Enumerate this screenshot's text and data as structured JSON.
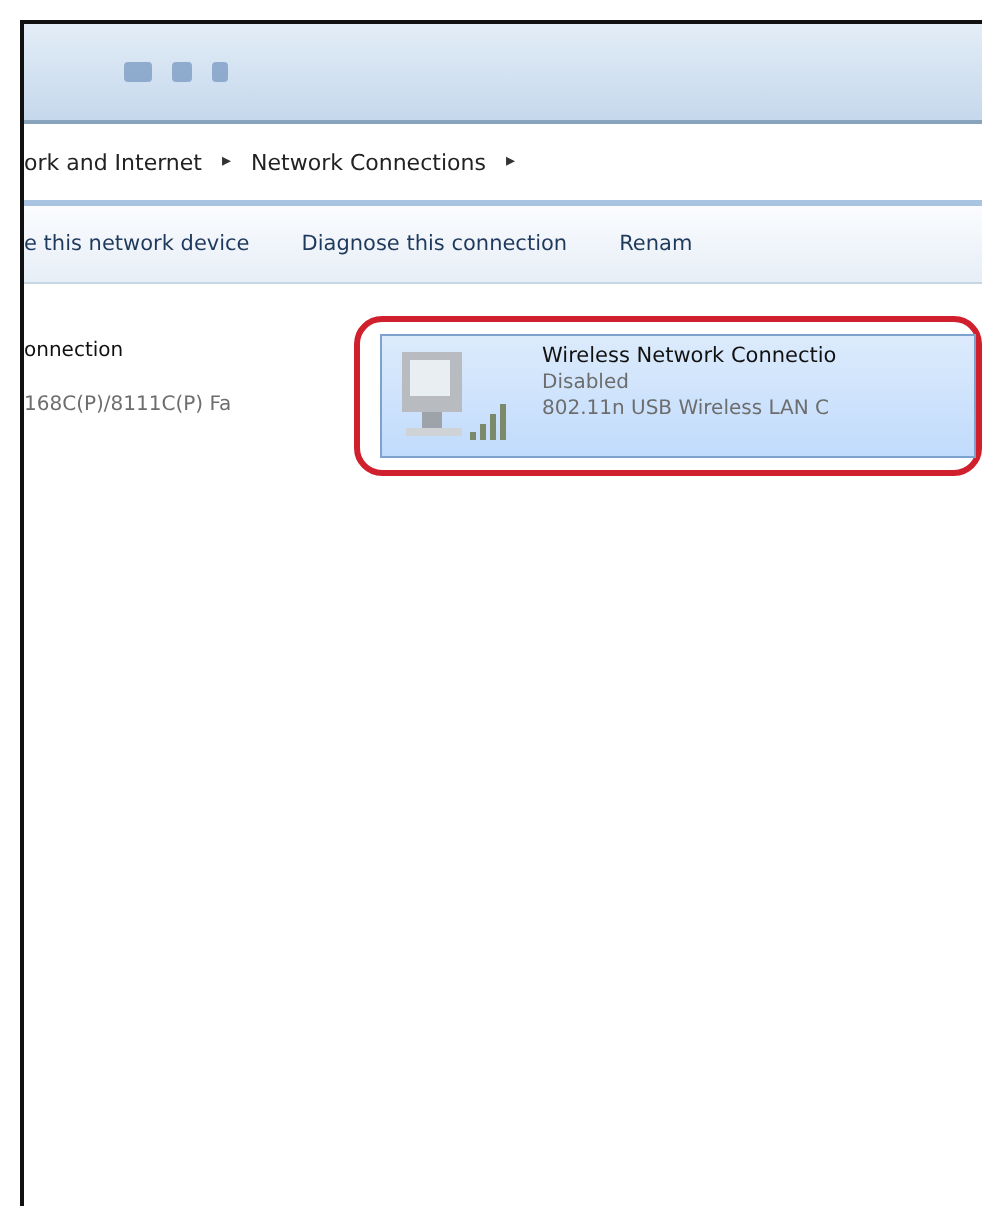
{
  "breadcrumb": {
    "items": [
      "ork and Internet",
      "Network Connections"
    ],
    "separator": "▸"
  },
  "toolbar": {
    "buttons": [
      "e this network device",
      "Diagnose this connection",
      "Renam"
    ]
  },
  "connections": [
    {
      "name": "onnection",
      "device": "168C(P)/8111C(P) Fa",
      "selected": false,
      "highlighted": false
    },
    {
      "name": "Wireless Network Connectio",
      "status": "Disabled",
      "device": "802.11n USB Wireless LAN C",
      "selected": true,
      "highlighted": true
    }
  ]
}
